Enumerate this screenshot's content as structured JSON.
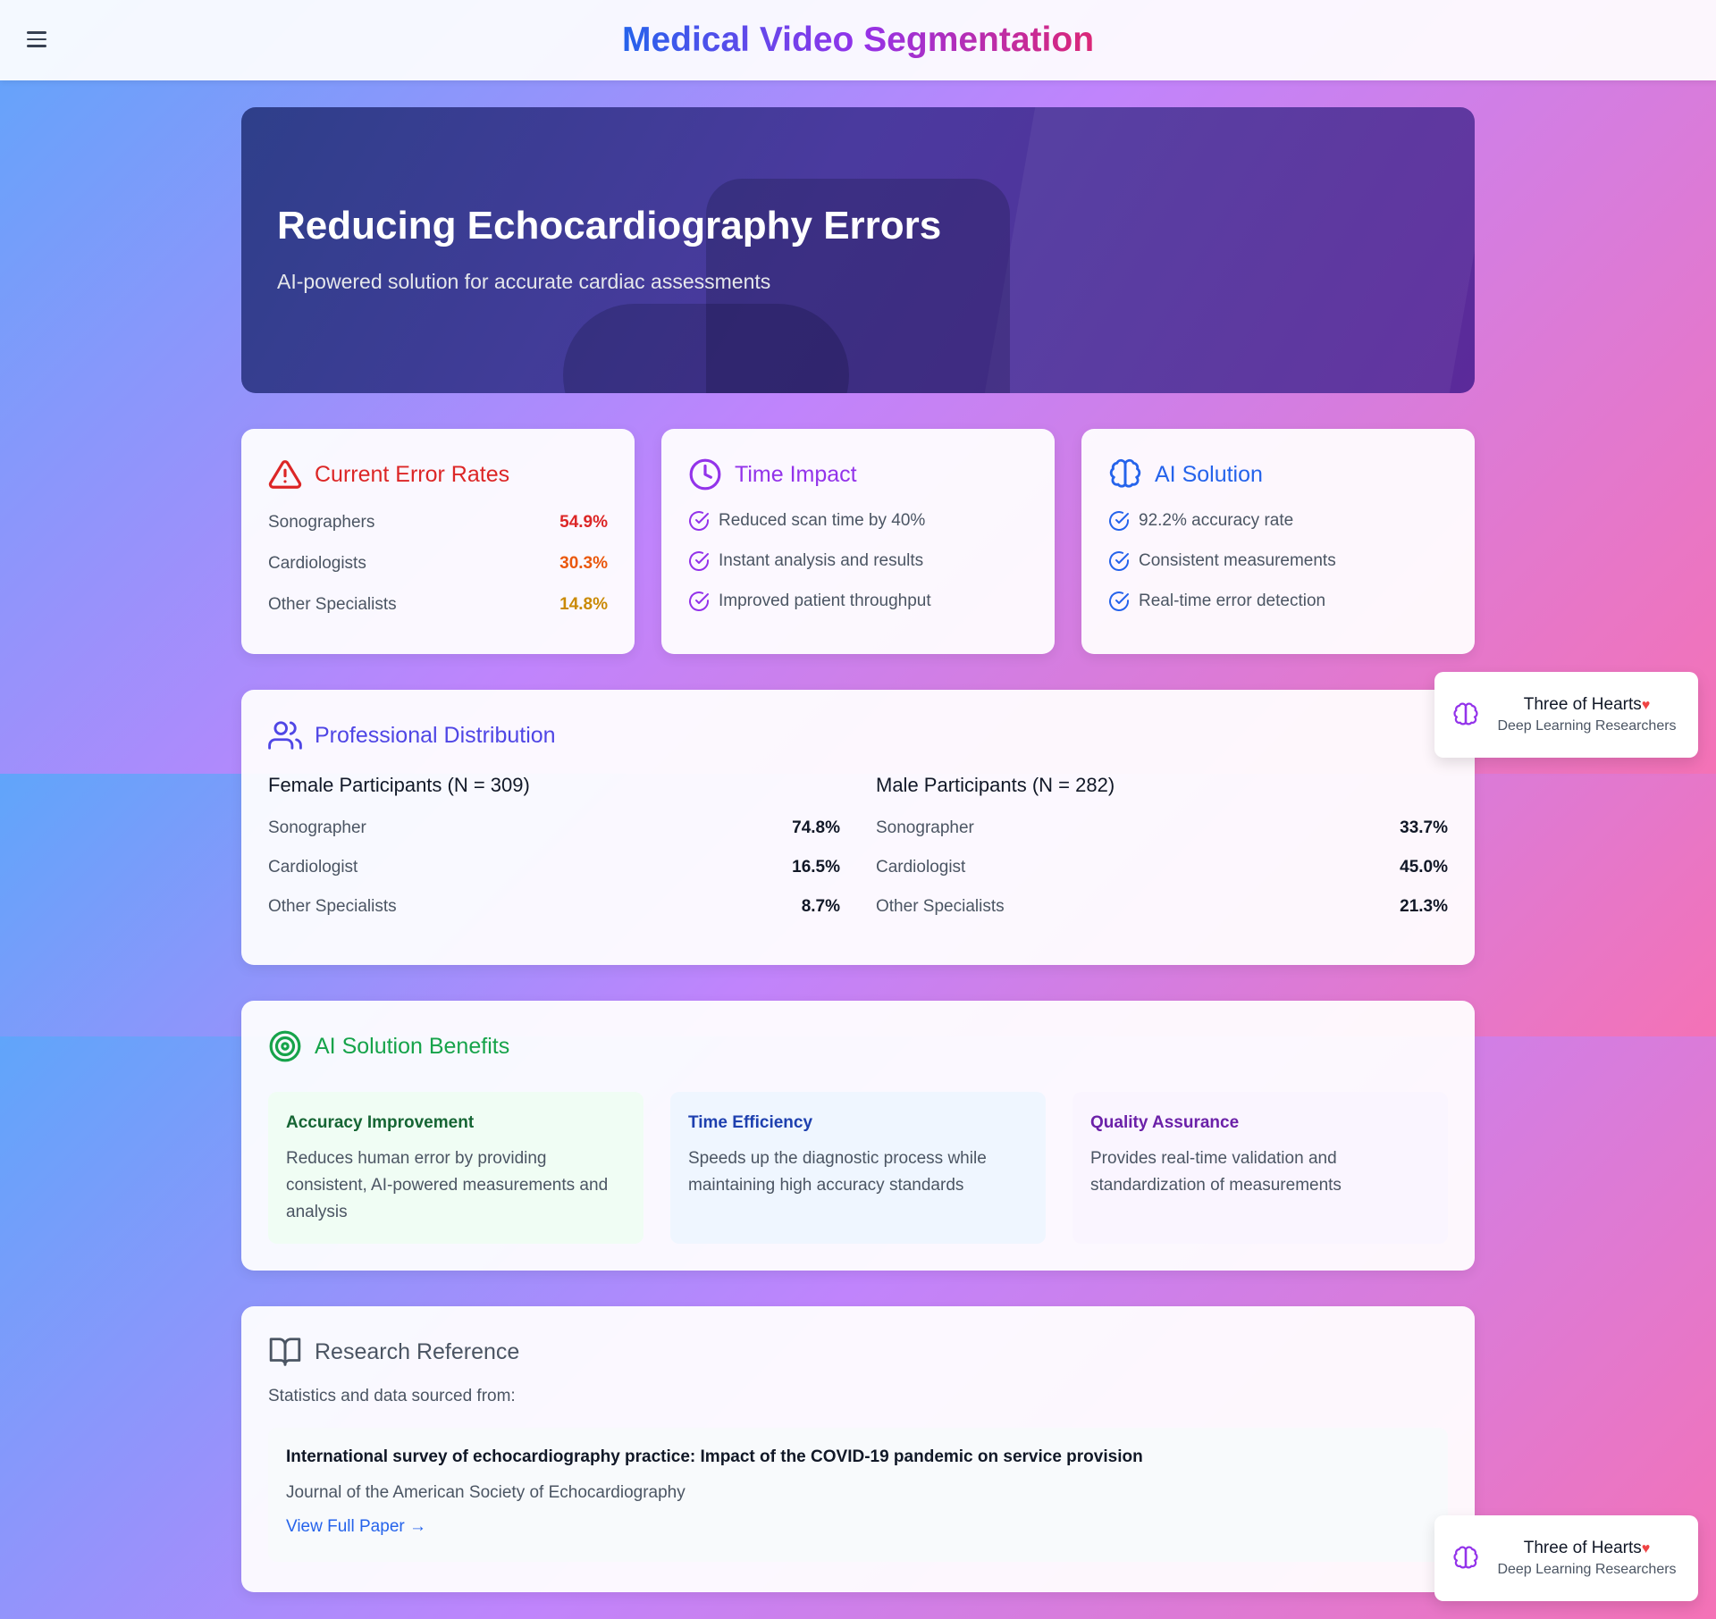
{
  "header": {
    "title": "Medical Video Segmentation",
    "menu_icon": "hamburger-menu-icon"
  },
  "hero": {
    "title": "Reducing Echocardiography Errors",
    "subtitle": "AI-powered solution for accurate cardiac assessments"
  },
  "error_rates": {
    "title": "Current Error Rates",
    "icon": "warning-triangle-icon",
    "rows": [
      {
        "label": "Sonographers",
        "value": "54.9%",
        "color": "#dc2626"
      },
      {
        "label": "Cardiologists",
        "value": "30.3%",
        "color": "#ea580c"
      },
      {
        "label": "Other Specialists",
        "value": "14.8%",
        "color": "#ca8a04"
      }
    ]
  },
  "time_impact": {
    "title": "Time Impact",
    "icon": "clock-icon",
    "items": [
      "Reduced scan time by 40%",
      "Instant analysis and results",
      "Improved patient throughput"
    ]
  },
  "ai_solution": {
    "title": "AI Solution",
    "icon": "brain-icon",
    "items": [
      "92.2% accuracy rate",
      "Consistent measurements",
      "Real-time error detection"
    ]
  },
  "distribution": {
    "title": "Professional Distribution",
    "icon": "users-icon",
    "female": {
      "heading": "Female Participants (N = 309)",
      "rows": [
        {
          "label": "Sonographer",
          "value": "74.8%"
        },
        {
          "label": "Cardiologist",
          "value": "16.5%"
        },
        {
          "label": "Other Specialists",
          "value": "8.7%"
        }
      ]
    },
    "male": {
      "heading": "Male Participants (N = 282)",
      "rows": [
        {
          "label": "Sonographer",
          "value": "33.7%"
        },
        {
          "label": "Cardiologist",
          "value": "45.0%"
        },
        {
          "label": "Other Specialists",
          "value": "21.3%"
        }
      ]
    }
  },
  "benefits": {
    "title": "AI Solution Benefits",
    "icon": "target-icon",
    "items": [
      {
        "title": "Accuracy Improvement",
        "text": "Reduces human error by providing consistent, AI-powered measurements and analysis"
      },
      {
        "title": "Time Efficiency",
        "text": "Speeds up the diagnostic process while maintaining high accuracy standards"
      },
      {
        "title": "Quality Assurance",
        "text": "Provides real-time validation and standardization of measurements"
      }
    ]
  },
  "reference": {
    "title": "Research Reference",
    "icon": "book-icon",
    "subtitle": "Statistics and data sourced from:",
    "paper_title": "International survey of echocardiography practice: Impact of the COVID-19 pandemic on service provision",
    "journal": "Journal of the American Society of Echocardiography",
    "link_label": "View Full Paper →"
  },
  "badge": {
    "name": "Three of Hearts",
    "heart": "♥",
    "role": "Deep Learning Researchers",
    "icon": "brain-icon"
  },
  "colors": {
    "error": "#dc2626",
    "time": "#9333ea",
    "ai": "#2563eb",
    "distribution": "#4f46e5",
    "benefits": "#16a34a",
    "reference": "#4b5563"
  }
}
